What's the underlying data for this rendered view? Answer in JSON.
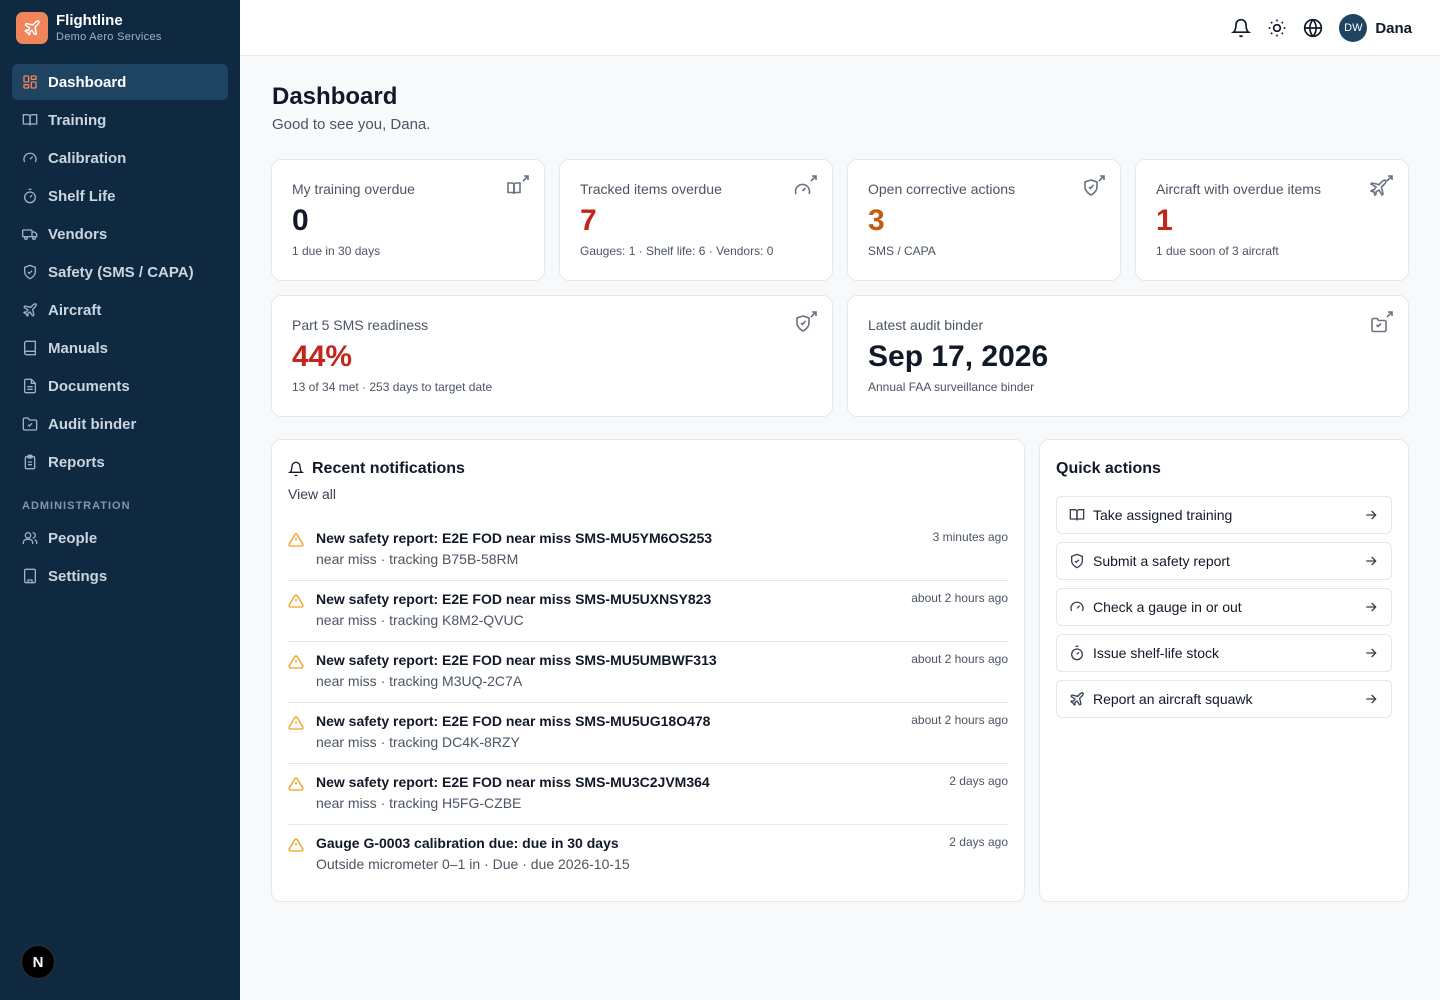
{
  "brand": {
    "name": "Flightline",
    "org": "Demo Aero Services",
    "accent": "#f2845a"
  },
  "sidebar": {
    "items": [
      {
        "label": "Dashboard",
        "icon": "dashboard-icon",
        "active": true
      },
      {
        "label": "Training",
        "icon": "book-icon"
      },
      {
        "label": "Calibration",
        "icon": "gauge-icon"
      },
      {
        "label": "Shelf Life",
        "icon": "timer-icon"
      },
      {
        "label": "Vendors",
        "icon": "truck-icon"
      },
      {
        "label": "Safety (SMS / CAPA)",
        "icon": "shield-icon"
      },
      {
        "label": "Aircraft",
        "icon": "plane-icon"
      },
      {
        "label": "Manuals",
        "icon": "manual-icon"
      },
      {
        "label": "Documents",
        "icon": "document-icon"
      },
      {
        "label": "Audit binder",
        "icon": "folder-check-icon"
      },
      {
        "label": "Reports",
        "icon": "clipboard-icon"
      }
    ],
    "admin_section": "ADMINISTRATION",
    "admin_items": [
      {
        "label": "People",
        "icon": "users-icon"
      },
      {
        "label": "Settings",
        "icon": "building-icon"
      }
    ],
    "badge": "N"
  },
  "topbar": {
    "avatar_initials": "DW",
    "user_name": "Dana"
  },
  "page": {
    "title": "Dashboard",
    "subtitle": "Good to see you, Dana."
  },
  "stats": [
    {
      "label": "My training overdue",
      "value": "0",
      "note": "1 due in 30 days",
      "icon": "book-icon"
    },
    {
      "label": "Tracked items overdue",
      "value": "7",
      "note": "Gauges: 1 · Shelf life: 6 · Vendors: 0",
      "icon": "gauge-icon"
    },
    {
      "label": "Open corrective actions",
      "value": "3",
      "note": "SMS / CAPA",
      "icon": "shield-icon"
    },
    {
      "label": "Aircraft with overdue items",
      "value": "1",
      "note": "1 due soon of 3 aircraft",
      "icon": "plane-icon"
    },
    {
      "label": "Part 5 SMS readiness",
      "value": "44%",
      "note": "13 of 34 met · 253 days to target date",
      "icon": "shield-icon"
    },
    {
      "label": "Latest audit binder",
      "value": "Sep 17, 2026",
      "note": "Annual FAA surveillance binder",
      "icon": "folder-check-icon"
    }
  ],
  "notifications": {
    "title": "Recent notifications",
    "view_all": "View all",
    "items": [
      {
        "title": "New safety report: E2E FOD near miss SMS-MU5YM6OS253",
        "sub": "near miss · tracking B75B-58RM",
        "time": "3 minutes ago"
      },
      {
        "title": "New safety report: E2E FOD near miss SMS-MU5UXNSY823",
        "sub": "near miss · tracking K8M2-QVUC",
        "time": "about 2 hours ago"
      },
      {
        "title": "New safety report: E2E FOD near miss SMS-MU5UMBWF313",
        "sub": "near miss · tracking M3UQ-2C7A",
        "time": "about 2 hours ago"
      },
      {
        "title": "New safety report: E2E FOD near miss SMS-MU5UG18O478",
        "sub": "near miss · tracking DC4K-8RZY",
        "time": "about 2 hours ago"
      },
      {
        "title": "New safety report: E2E FOD near miss SMS-MU3C2JVM364",
        "sub": "near miss · tracking H5FG-CZBE",
        "time": "2 days ago"
      },
      {
        "title": "Gauge G-0003 calibration due: due in 30 days",
        "sub": "Outside micrometer 0–1 in · Due · due 2026-10-15",
        "time": "2 days ago"
      }
    ]
  },
  "quick_actions": {
    "title": "Quick actions",
    "items": [
      {
        "label": "Take assigned training",
        "icon": "book-icon"
      },
      {
        "label": "Submit a safety report",
        "icon": "shield-icon"
      },
      {
        "label": "Check a gauge in or out",
        "icon": "gauge-icon"
      },
      {
        "label": "Issue shelf-life stock",
        "icon": "timer-icon"
      },
      {
        "label": "Report an aircraft squawk",
        "icon": "plane-icon"
      }
    ]
  },
  "colors": {
    "sidebar_bg": "#0f2a40",
    "red": "#c2261d",
    "orange": "#c35a10",
    "warning": "#f0a020"
  }
}
